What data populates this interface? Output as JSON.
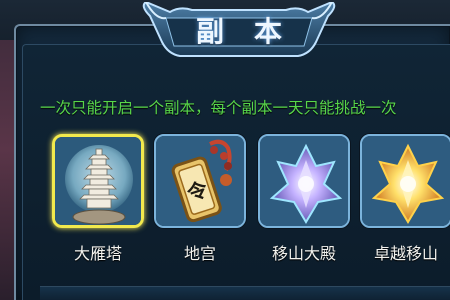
{
  "dialog": {
    "title_chars": [
      "副",
      "本"
    ],
    "notice": "一次只能开启一个副本，每个副本一天只能挑战一次"
  },
  "dungeons": [
    {
      "label": "大雁塔",
      "icon": "pagoda-icon",
      "selected": true
    },
    {
      "label": "地宫",
      "icon": "token-icon",
      "selected": false
    },
    {
      "label": "移山大殿",
      "icon": "purple-crystal-icon",
      "selected": false
    },
    {
      "label": "卓越移山",
      "icon": "golden-crystal-icon",
      "selected": false
    }
  ],
  "colors": {
    "notice_text": "#58d64a",
    "selected_border": "#f2e94d",
    "tile_border": "#7cb4dc"
  }
}
